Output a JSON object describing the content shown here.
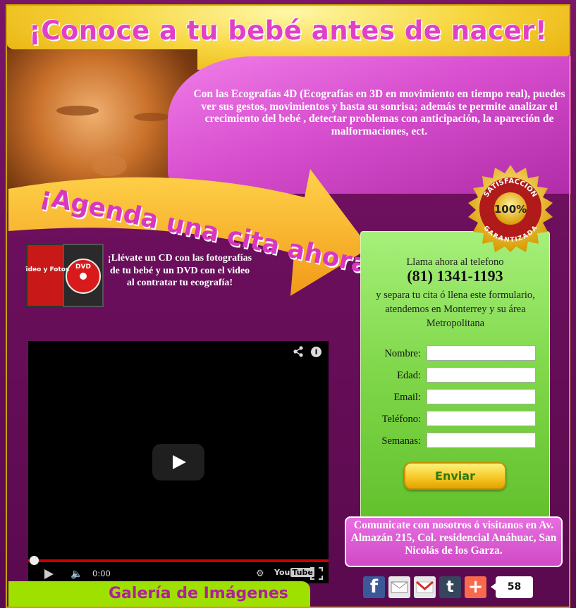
{
  "header": {
    "title": "¡Conoce a tu bebé antes de nacer!"
  },
  "intro": {
    "description": "Con las Ecografías 4D (Ecografías en 3D en movimiento en tiempo real), puedes ver sus gestos, movimientos y hasta su sonrisa; además te permite analizar el crecimiento del bebé , detectar problemas con anticipación, la apareción de malformaciones, ect."
  },
  "banner": {
    "cta": "¡Agenda una cita ahora!"
  },
  "promo": {
    "dvd_label": "DVD",
    "dvd_cover": "Video y Fotos",
    "text": "¡Llévate un CD con las fotografías de tu bebé y un DVD con el video al contratar tu ecografía!"
  },
  "seal": {
    "top": "SATISFACCION",
    "center": "100%",
    "bottom": "GARANTIZADA"
  },
  "form": {
    "call_label": "Llama ahora al telefono",
    "phone": "(81) 1341-1193",
    "subtitle": "y separa tu cita ó llena este formulario, atendemos en Monterrey y su área Metropolitana",
    "fields": [
      {
        "label": "Nombre:",
        "value": ""
      },
      {
        "label": "Edad:",
        "value": ""
      },
      {
        "label": "Email:",
        "value": ""
      },
      {
        "label": "Teléfono:",
        "value": ""
      },
      {
        "label": "Semanas:",
        "value": ""
      }
    ],
    "submit_label": "Enviar"
  },
  "address": {
    "text": "Comunicate con nosotros ó visitanos en Av. Almazán 215, Col. residencial Anáhuac, San Nicolás de los Garza."
  },
  "video": {
    "time": "0:00",
    "brand_you": "You",
    "brand_tube": "Tube",
    "progress": 0
  },
  "gallery": {
    "label": "Galería de Imágenes"
  },
  "share": {
    "icons": [
      "facebook-icon",
      "email-icon",
      "gmail-icon",
      "tumblr-icon",
      "addthis-icon"
    ],
    "count": "58",
    "colors": {
      "facebook": "#3b5998",
      "email": "#e8e8e8",
      "gmail": "#e8e8e8",
      "tumblr": "#35465c",
      "addthis": "#f8694d"
    }
  },
  "colors": {
    "accent_pink": "#e040c8",
    "form_green": "#7ed648",
    "button_yellow": "#f7c92a",
    "gallery_green": "#9ee000"
  }
}
